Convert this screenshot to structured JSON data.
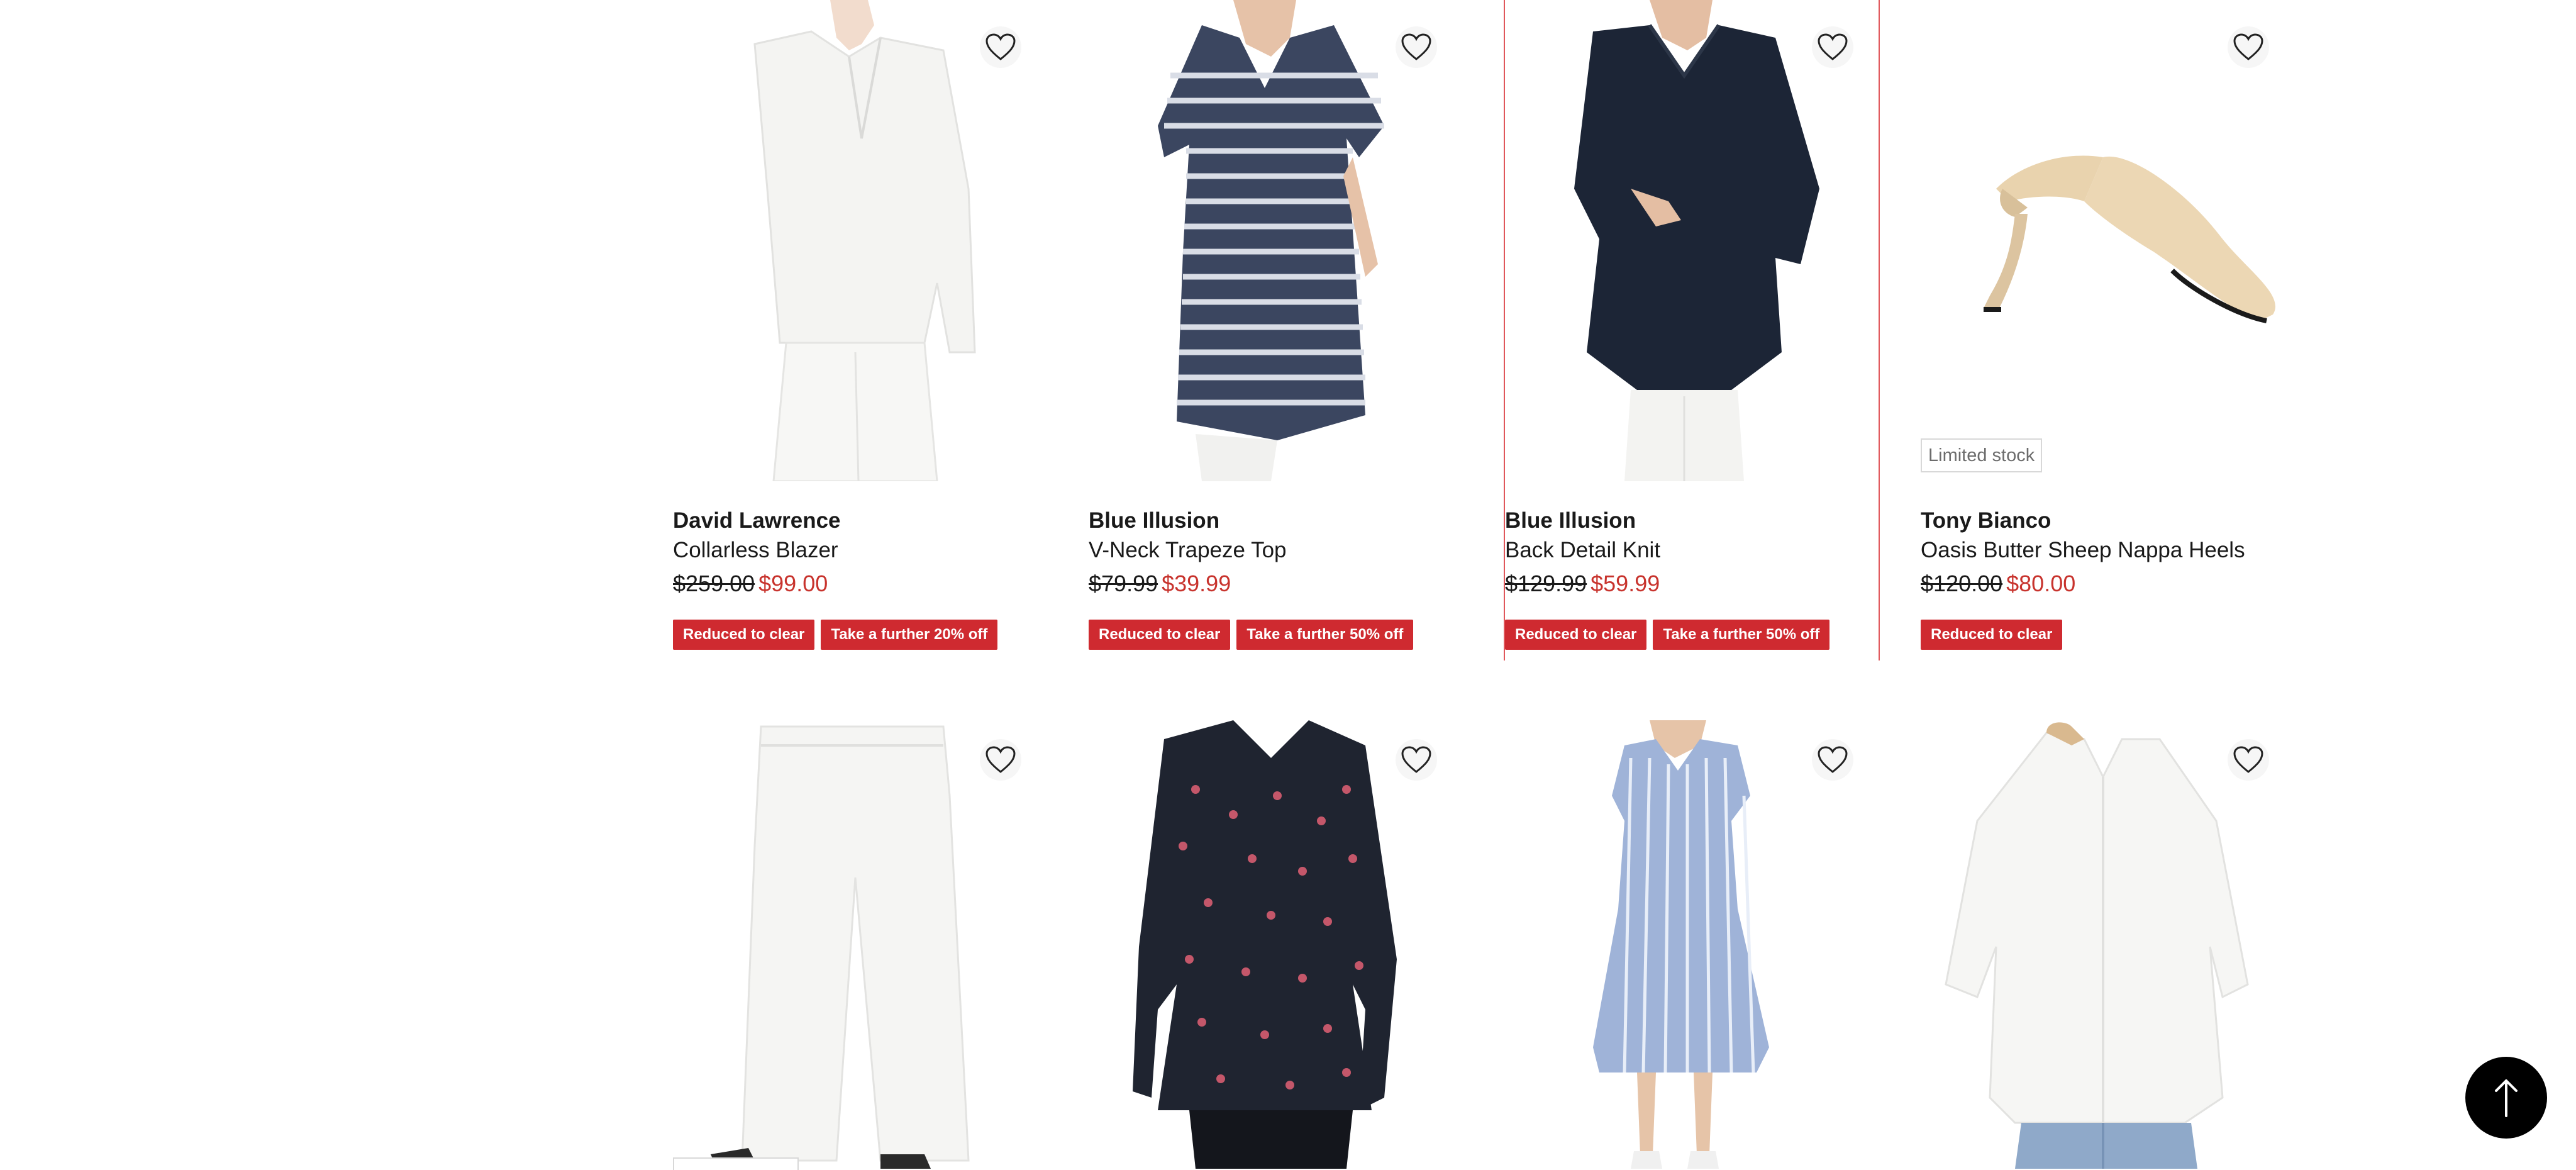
{
  "products": [
    {
      "brand": "David Lawrence",
      "name": "Collarless Blazer",
      "was": "$259.00",
      "now": "$99.00",
      "badges": [
        "Reduced to clear",
        "Take a further 20% off"
      ],
      "image": "white-blazer-model"
    },
    {
      "brand": "Blue Illusion",
      "name": "V-Neck Trapeze Top",
      "was": "$79.99",
      "now": "$39.99",
      "badges": [
        "Reduced to clear",
        "Take a further 50% off"
      ],
      "image": "striped-top-model"
    },
    {
      "brand": "Blue Illusion",
      "name": "Back Detail Knit",
      "was": "$129.99",
      "now": "$59.99",
      "badges": [
        "Reduced to clear",
        "Take a further 50% off"
      ],
      "image": "navy-knit-model"
    },
    {
      "brand": "Tony Bianco",
      "name": "Oasis Butter Sheep Nappa Heels",
      "was": "$120.00",
      "now": "$80.00",
      "badges": [
        "Reduced to clear"
      ],
      "stock_label": "Limited stock",
      "image": "butter-mule-heel"
    }
  ],
  "second_row_images": [
    "white-wide-leg-pants",
    "navy-dot-peplum-top",
    "blue-stripe-maternity-dress",
    "white-oversized-shirt"
  ],
  "colors": {
    "sale_red": "#cf2a30",
    "price_red": "#c8332d",
    "selected_outline": "#e0575b",
    "back_to_top_bg": "#000000"
  },
  "icons": {
    "wishlist": "heart-outline-icon",
    "back_to_top": "arrow-up-icon"
  }
}
